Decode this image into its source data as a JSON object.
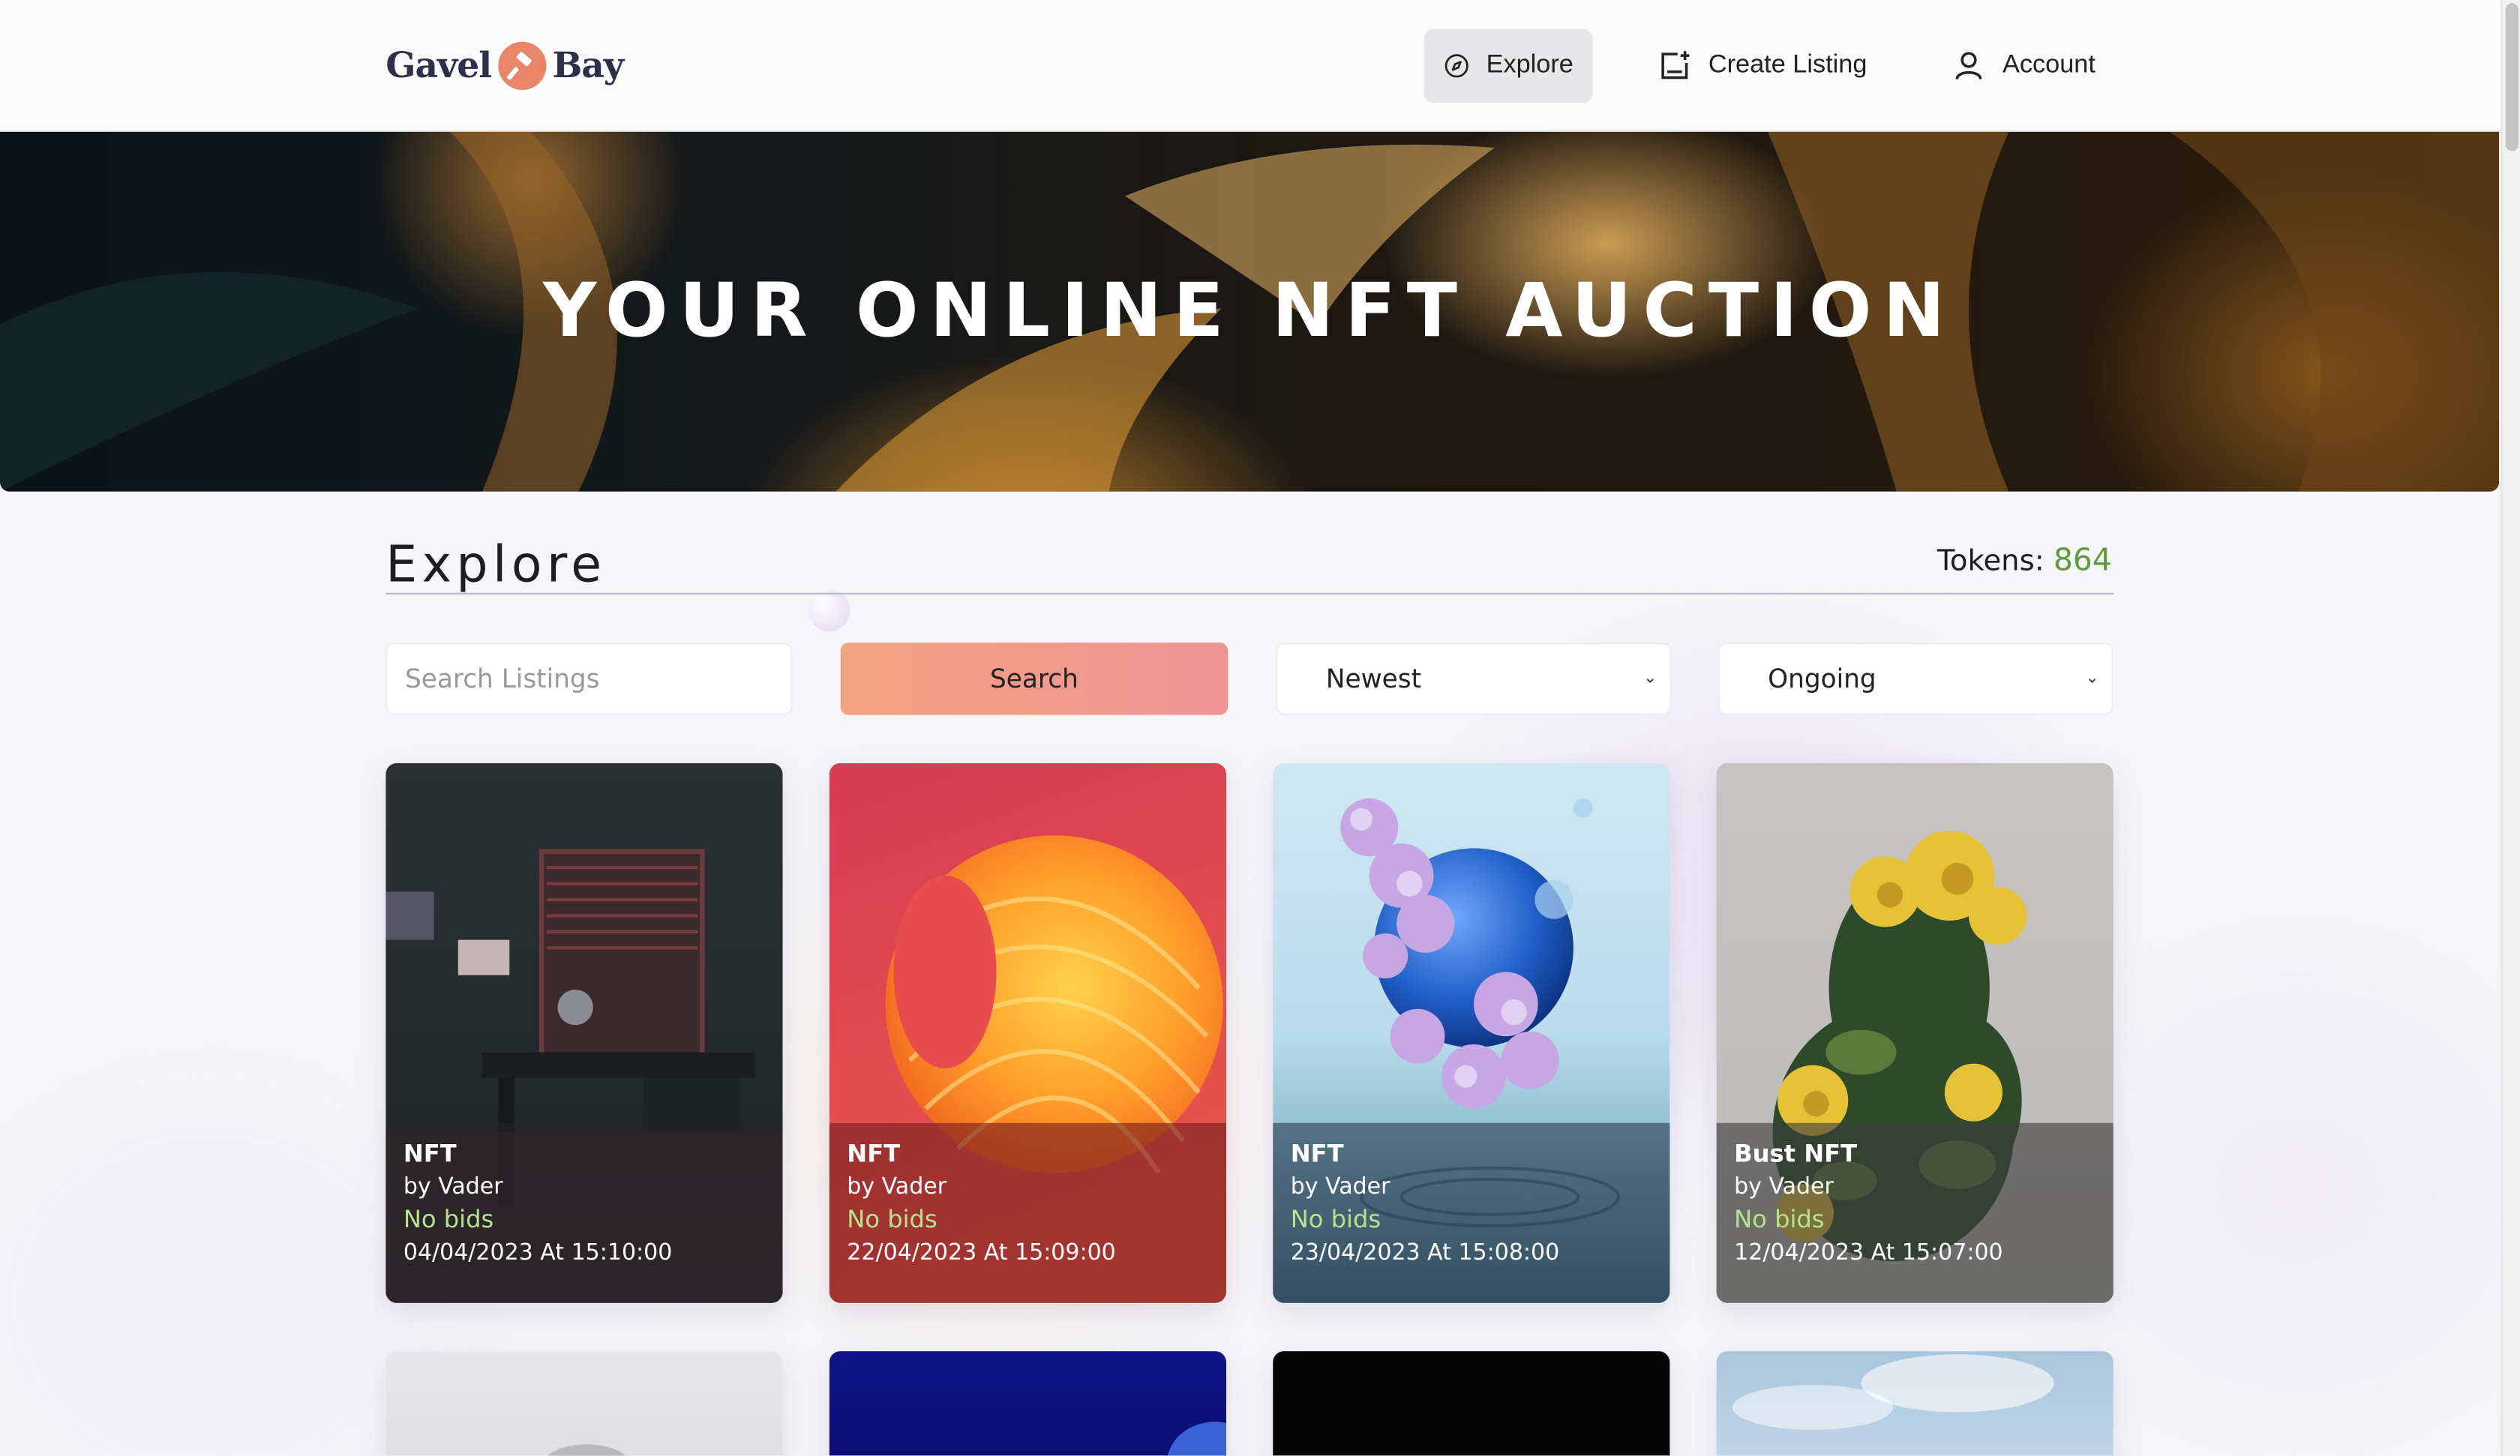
{
  "header": {
    "logo_text_left": "Gavel",
    "logo_text_right": "Bay",
    "nav": [
      {
        "label": "Explore",
        "icon": "compass-icon",
        "active": true
      },
      {
        "label": "Create Listing",
        "icon": "add-square-icon",
        "active": false
      },
      {
        "label": "Account",
        "icon": "user-icon",
        "active": false
      }
    ]
  },
  "hero": {
    "title": "YOUR ONLINE NFT AUCTION"
  },
  "explore": {
    "title": "Explore",
    "tokens_label": "Tokens:",
    "tokens_value": "864",
    "search_placeholder": "Search Listings",
    "search_button": "Search",
    "sort_selected": "Newest",
    "status_selected": "Ongoing"
  },
  "listings": [
    {
      "title": "NFT",
      "creator": "by Vader",
      "bids": "No bids",
      "date": "04/04/2023 At 15:10:00"
    },
    {
      "title": "NFT",
      "creator": "by Vader",
      "bids": "No bids",
      "date": "22/04/2023 At 15:09:00"
    },
    {
      "title": "NFT",
      "creator": "by Vader",
      "bids": "No bids",
      "date": "23/04/2023 At 15:08:00"
    },
    {
      "title": "Bust NFT",
      "creator": "by Vader",
      "bids": "No bids",
      "date": "12/04/2023 At 15:07:00"
    }
  ],
  "colors": {
    "accent_start": "#f2a480",
    "accent_end": "#ef9294",
    "tokens": "#5c9b3e",
    "bids": "#b6e38e"
  }
}
